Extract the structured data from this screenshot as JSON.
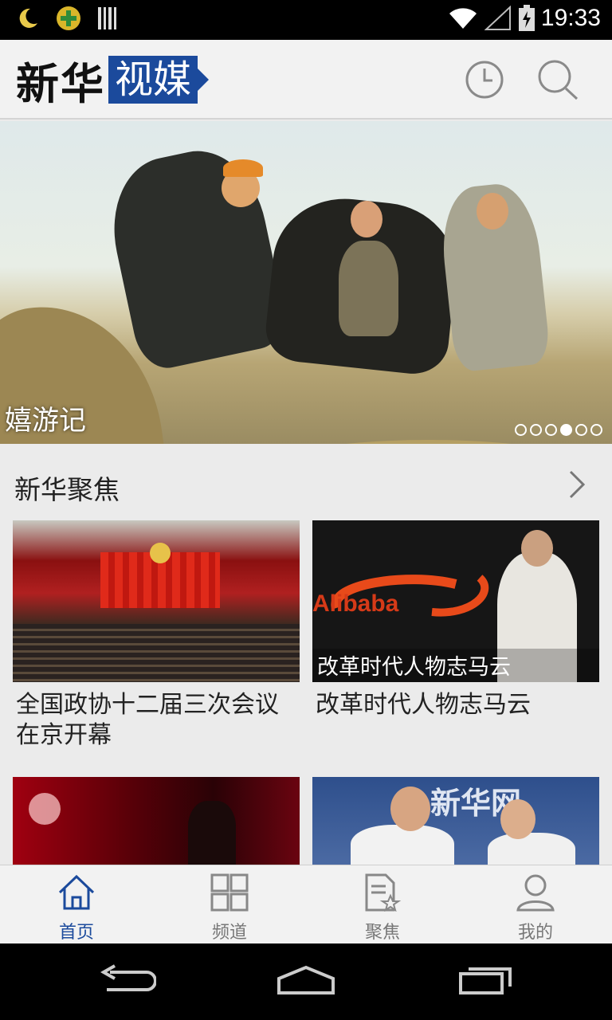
{
  "status_bar": {
    "time": "19:33",
    "icons": [
      "moon-icon",
      "app-plus-icon",
      "barcode-icon",
      "wifi-icon",
      "signal-icon",
      "battery-icon"
    ]
  },
  "app_bar": {
    "logo_black": "新华",
    "logo_box": "视媒",
    "actions": [
      "history-clock-icon",
      "search-icon"
    ]
  },
  "banner": {
    "caption": "嬉游记",
    "page_indicator": {
      "total": 6,
      "active_index": 3
    }
  },
  "section": {
    "title": "新华聚焦",
    "cards": [
      {
        "title": "全国政协十二届三次会议在京开幕",
        "overlay": ""
      },
      {
        "title": "改革时代人物志马云",
        "overlay": "改革时代人物志马云",
        "overlay_logo": "Alibaba"
      },
      {
        "title": "",
        "overlay": ""
      },
      {
        "title": "",
        "overlay": "",
        "overlay_logo": "新华网"
      }
    ]
  },
  "bottom_nav": {
    "items": [
      {
        "label": "首页",
        "icon": "home-icon",
        "active": true
      },
      {
        "label": "频道",
        "icon": "grid-icon",
        "active": false
      },
      {
        "label": "聚焦",
        "icon": "document-star-icon",
        "active": false
      },
      {
        "label": "我的",
        "icon": "person-icon",
        "active": false
      }
    ]
  },
  "colors": {
    "accent": "#1b4a9c",
    "background": "#ebebeb",
    "status_bar": "#000000"
  }
}
